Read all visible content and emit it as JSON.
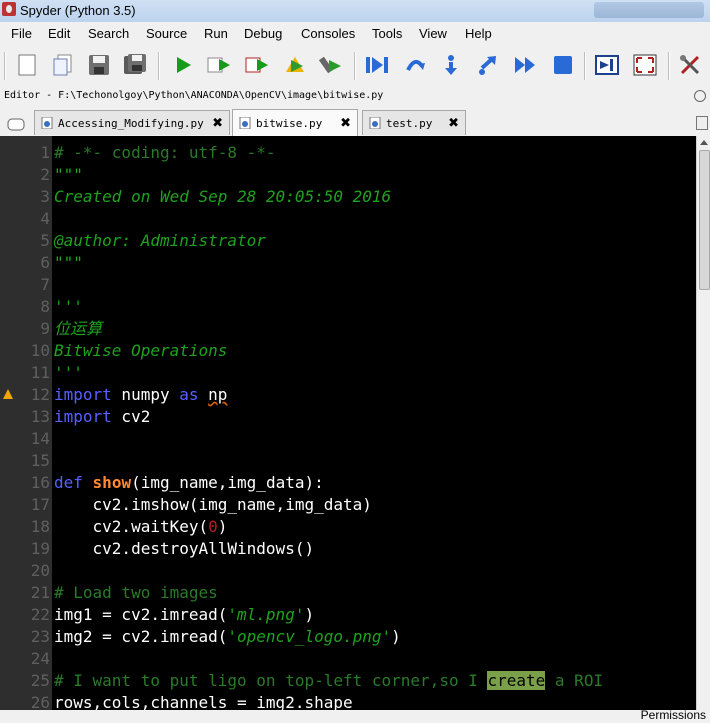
{
  "window": {
    "title": "Spyder (Python 3.5)"
  },
  "menu": [
    {
      "label": "File",
      "key": "menu-file"
    },
    {
      "label": "Edit",
      "key": "menu-edit"
    },
    {
      "label": "Search",
      "key": "menu-search"
    },
    {
      "label": "Source",
      "key": "menu-source"
    },
    {
      "label": "Run",
      "key": "menu-run"
    },
    {
      "label": "Debug",
      "key": "menu-debug"
    },
    {
      "label": "Consoles",
      "key": "menu-consoles"
    },
    {
      "label": "Tools",
      "key": "menu-tools"
    },
    {
      "label": "View",
      "key": "menu-view"
    },
    {
      "label": "Help",
      "key": "menu-help"
    }
  ],
  "toolbar": [
    {
      "icon": "new-file-icon",
      "color": "#ffffff"
    },
    {
      "icon": "open-file-icon",
      "color": "#ffffff"
    },
    {
      "icon": "save-icon",
      "color": "#6f6f6f"
    },
    {
      "icon": "save-all-icon",
      "color": "#6f6f6f"
    },
    {
      "icon": "run-icon",
      "color": "#1a9a1a"
    },
    {
      "icon": "run-cell-icon",
      "color": "#1a9a1a"
    },
    {
      "icon": "run-cell-advance-icon",
      "color": "#1a9a1a"
    },
    {
      "icon": "run-selection-icon",
      "color": "#2c9a2c"
    },
    {
      "icon": "run-configure-icon",
      "color": "#2c9a2c"
    },
    {
      "icon": "debug-icon",
      "color": "#2a6ad6"
    },
    {
      "icon": "step-icon",
      "color": "#2a6ad6"
    },
    {
      "icon": "step-into-icon",
      "color": "#2a6ad6"
    },
    {
      "icon": "step-return-icon",
      "color": "#2a6ad6"
    },
    {
      "icon": "continue-icon",
      "color": "#2a6ad6"
    },
    {
      "icon": "stop-debug-icon",
      "color": "#2a6ad6"
    },
    {
      "icon": "maximize-pane-icon",
      "color": "#1f3f8f"
    },
    {
      "icon": "fullscreen-icon",
      "color": "#b0201f"
    },
    {
      "icon": "preferences-icon",
      "color": "#b0201f"
    }
  ],
  "editor": {
    "path": "Editor - F:\\Techonolgoy\\Python\\ANACONDA\\OpenCV\\image\\bitwise.py",
    "tabs": [
      {
        "label": "Accessing_Modifying.py",
        "active": false
      },
      {
        "label": "bitwise.py",
        "active": true
      },
      {
        "label": "test.py",
        "active": false
      }
    ],
    "close_glyph": "✖",
    "lines": [
      {
        "n": "1",
        "parts": [
          {
            "t": "# -*- coding: utf-8 -*-",
            "c": "c-dimcomment"
          }
        ]
      },
      {
        "n": "2",
        "parts": [
          {
            "t": "\"\"\"",
            "c": "c-comment"
          }
        ]
      },
      {
        "n": "3",
        "parts": [
          {
            "t": "Created on Wed Sep 28 20:05:50 2016",
            "c": "c-italic"
          }
        ]
      },
      {
        "n": "4",
        "parts": []
      },
      {
        "n": "5",
        "parts": [
          {
            "t": "@author: Administrator",
            "c": "c-italic"
          }
        ]
      },
      {
        "n": "6",
        "parts": [
          {
            "t": "\"\"\"",
            "c": "c-comment"
          }
        ]
      },
      {
        "n": "7",
        "parts": []
      },
      {
        "n": "8",
        "parts": [
          {
            "t": "'''",
            "c": "c-comment"
          }
        ]
      },
      {
        "n": "9",
        "parts": [
          {
            "t": "位运算",
            "c": "c-italic"
          }
        ]
      },
      {
        "n": "10",
        "parts": [
          {
            "t": "Bitwise Operations",
            "c": "c-italic"
          }
        ]
      },
      {
        "n": "11",
        "parts": [
          {
            "t": "'''",
            "c": "c-comment"
          }
        ]
      },
      {
        "n": "12",
        "warn": true,
        "parts": [
          {
            "t": "import",
            "c": "c-kw"
          },
          {
            "t": " numpy "
          },
          {
            "t": "as",
            "c": "c-kw"
          },
          {
            "t": " "
          },
          {
            "t": "np",
            "c": "c-underline"
          }
        ]
      },
      {
        "n": "13",
        "parts": [
          {
            "t": "import",
            "c": "c-kw"
          },
          {
            "t": " cv2"
          }
        ]
      },
      {
        "n": "14",
        "parts": []
      },
      {
        "n": "15",
        "parts": []
      },
      {
        "n": "16",
        "parts": [
          {
            "t": "def",
            "c": "c-kw"
          },
          {
            "t": " "
          },
          {
            "t": "show",
            "c": "c-fn"
          },
          {
            "t": "(img_name,img_data):"
          }
        ]
      },
      {
        "n": "17",
        "parts": [
          {
            "t": "    cv2.imshow(img_name,img_data)"
          }
        ]
      },
      {
        "n": "18",
        "parts": [
          {
            "t": "    cv2.waitKey("
          },
          {
            "t": "0",
            "c": "c-num"
          },
          {
            "t": ")"
          }
        ]
      },
      {
        "n": "19",
        "parts": [
          {
            "t": "    cv2.destroyAllWindows()"
          }
        ]
      },
      {
        "n": "20",
        "parts": []
      },
      {
        "n": "21",
        "parts": [
          {
            "t": "# Load two images",
            "c": "c-dimcomment"
          }
        ]
      },
      {
        "n": "22",
        "parts": [
          {
            "t": "img1 = cv2.imread("
          },
          {
            "t": "'ml.png'",
            "c": "c-str"
          },
          {
            "t": ")"
          }
        ]
      },
      {
        "n": "23",
        "parts": [
          {
            "t": "img2 = cv2.imread("
          },
          {
            "t": "'opencv_logo.png'",
            "c": "c-str"
          },
          {
            "t": ")"
          }
        ]
      },
      {
        "n": "24",
        "parts": []
      },
      {
        "n": "25",
        "parts": [
          {
            "t": "# I want to put ligo on top-left corner,so I ",
            "c": "c-dimcomment"
          },
          {
            "t": "create",
            "c": "c-highlight"
          },
          {
            "t": " a ROI",
            "c": "c-dimcomment"
          }
        ]
      },
      {
        "n": "26",
        "parts": [
          {
            "t": "rows,cols,channels = img2.shape"
          }
        ]
      }
    ]
  },
  "status": {
    "permissions": "Permissions"
  }
}
